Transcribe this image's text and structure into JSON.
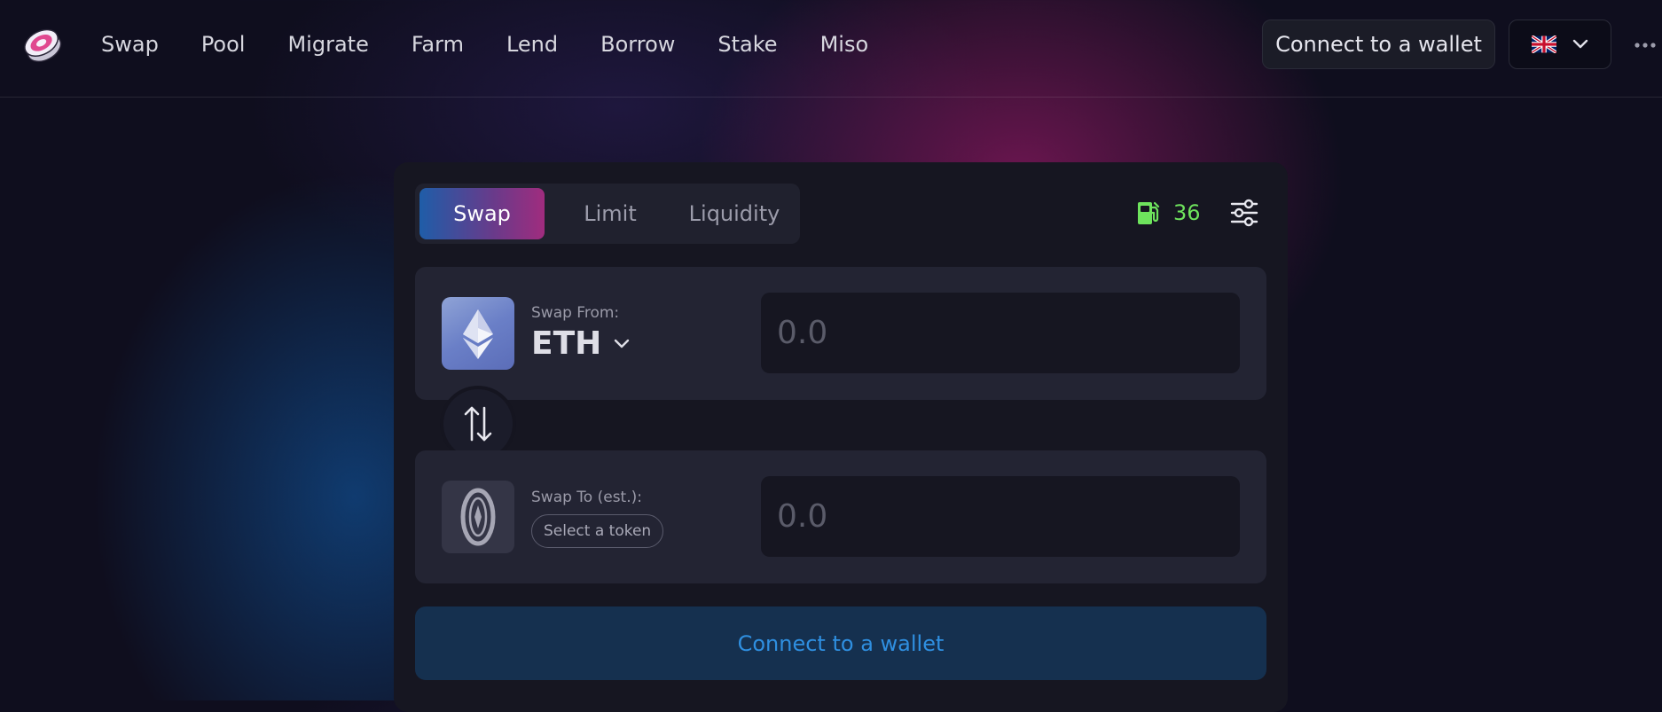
{
  "header": {
    "nav": [
      "Swap",
      "Pool",
      "Migrate",
      "Farm",
      "Lend",
      "Borrow",
      "Stake",
      "Miso"
    ],
    "connect_label": "Connect to a wallet",
    "language_icon": "uk-flag-icon",
    "more_icon": "ellipsis-icon"
  },
  "swap": {
    "tabs": [
      {
        "label": "Swap",
        "active": true
      },
      {
        "label": "Limit",
        "active": false
      },
      {
        "label": "Liquidity",
        "active": false
      }
    ],
    "gas_price": "36",
    "gas_icon": "gas-pump-icon",
    "settings_icon": "sliders-icon",
    "from": {
      "label": "Swap From:",
      "token": "ETH",
      "placeholder": "0.0"
    },
    "to": {
      "label": "Swap To (est.):",
      "select_label": "Select a token",
      "placeholder": "0.0"
    },
    "connect_label": "Connect to a wallet"
  },
  "colors": {
    "background": "#0f0e1e",
    "card": "#161621",
    "panel": "#232433",
    "gas_green": "#6ee35d",
    "connect_blue_text": "#2f8fe0",
    "connect_blue_bg": "#15304f"
  }
}
